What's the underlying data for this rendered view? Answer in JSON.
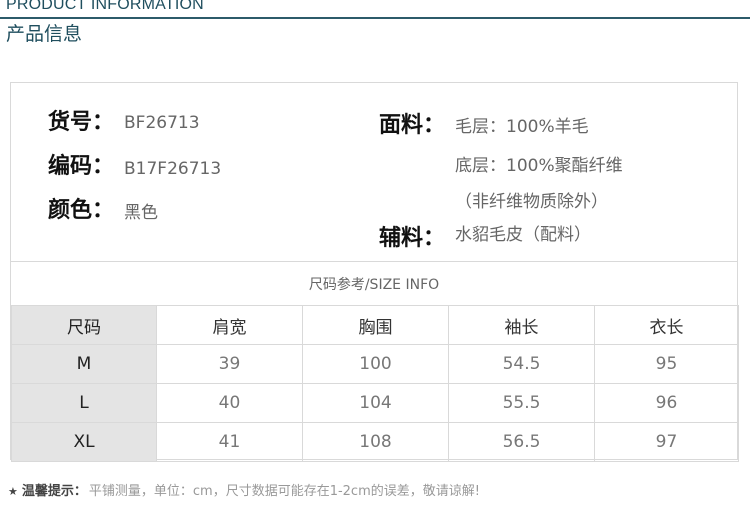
{
  "header": {
    "title_en": "PRODUCT INFORMATION",
    "title_cn": "产品信息"
  },
  "product": {
    "item_no_label": "货号：",
    "item_no": "BF26713",
    "code_label": "编码：",
    "code": "B17F26713",
    "color_label": "颜色：",
    "color": "黑色",
    "fabric_label": "面料：",
    "fabric_lines": [
      "毛层：100%羊毛",
      "底层：100%聚酯纤维",
      "（非纤维物质除外）"
    ],
    "accessory_label": "辅料：",
    "accessory": "水貂毛皮（配料）"
  },
  "size_info": {
    "title": "尺码参考/SIZE INFO",
    "headers": [
      "尺码",
      "肩宽",
      "胸围",
      "袖长",
      "衣长"
    ],
    "rows": [
      [
        "M",
        "39",
        "100",
        "54.5",
        "95"
      ],
      [
        "L",
        "40",
        "104",
        "55.5",
        "96"
      ],
      [
        "XL",
        "41",
        "108",
        "56.5",
        "97"
      ]
    ]
  },
  "footnote": {
    "star": "★",
    "label": "温馨提示：",
    "text": "平铺测量，单位：cm，尺寸数据可能存在1-2cm的误差，敬请谅解!"
  }
}
